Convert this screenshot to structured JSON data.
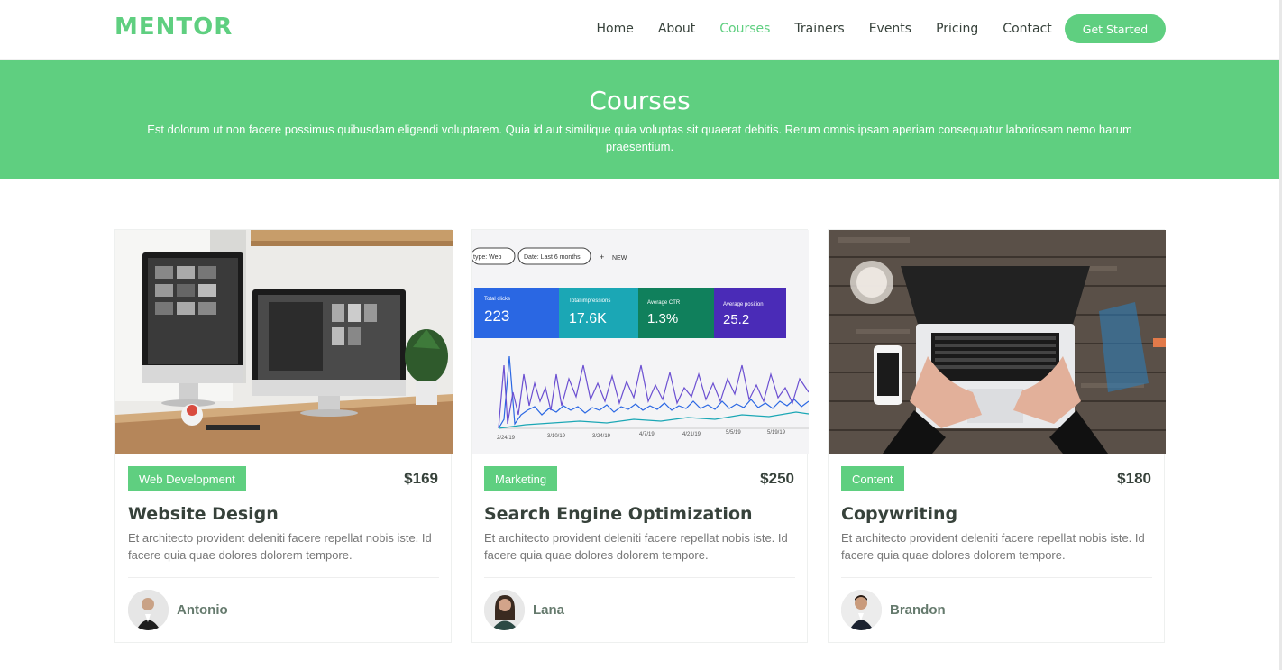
{
  "header": {
    "logo": "MENTOR",
    "nav": [
      "Home",
      "About",
      "Courses",
      "Trainers",
      "Events",
      "Pricing",
      "Contact"
    ],
    "active_nav": "Courses",
    "cta": "Get Started"
  },
  "hero": {
    "title": "Courses",
    "subtitle": "Est dolorum ut non facere possimus quibusdam eligendi voluptatem. Quia id aut similique quia voluptas sit quaerat debitis. Rerum omnis ipsam aperiam consequatur laboriosam nemo harum praesentium."
  },
  "courses": [
    {
      "category": "Web Development",
      "price": "$169",
      "title": "Website Design",
      "description": "Et architecto provident deleniti facere repellat nobis iste. Id facere quia quae dolores dolorem tempore.",
      "trainer": "Antonio",
      "image": "desk-monitors-photo"
    },
    {
      "category": "Marketing",
      "price": "$250",
      "title": "Search Engine Optimization",
      "description": "Et architecto provident deleniti facere repellat nobis iste. Id facere quia quae dolores dolorem tempore.",
      "trainer": "Lana",
      "image": "analytics-dashboard-photo",
      "dashboard": {
        "filters": [
          "type: Web",
          "Date: Last 6 months",
          "NEW"
        ],
        "metrics": [
          {
            "label": "Total clicks",
            "value": "223"
          },
          {
            "label": "Total impressions",
            "value": "17.6K"
          },
          {
            "label": "Average CTR",
            "value": "1.3%"
          },
          {
            "label": "Average position",
            "value": "25.2"
          }
        ],
        "dates": [
          "2/24/19",
          "3/10/19",
          "3/24/19",
          "4/7/19",
          "4/21/19",
          "5/5/19",
          "5/19/19"
        ]
      }
    },
    {
      "category": "Content",
      "price": "$180",
      "title": "Copywriting",
      "description": "Et architecto provident deleniti facere repellat nobis iste. Id facere quia quae dolores dolorem tempore.",
      "trainer": "Brandon",
      "image": "laptop-typing-photo"
    }
  ],
  "colors": {
    "accent": "#5fcf80",
    "text": "#37423b"
  }
}
